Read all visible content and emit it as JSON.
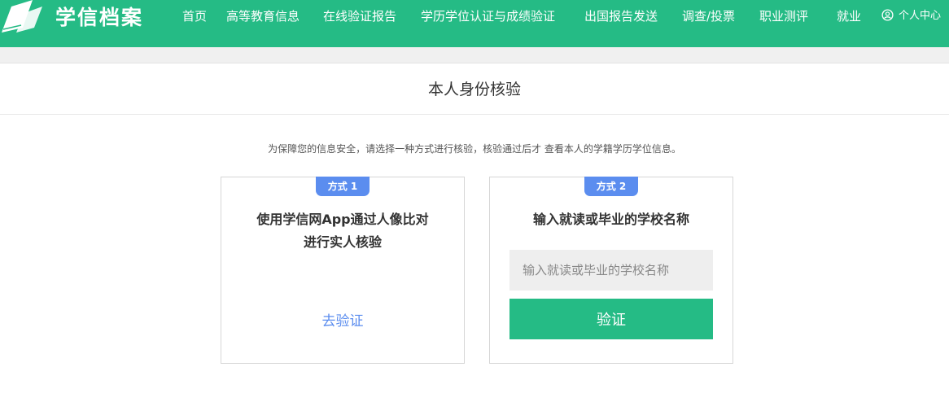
{
  "header": {
    "logo_text": "学信档案",
    "logo_icon": "open-book-icon",
    "nav": [
      {
        "label": "首页"
      },
      {
        "label": "高等教育信息"
      },
      {
        "label": "在线验证报告"
      },
      {
        "label": "学历学位认证与成绩验证"
      },
      {
        "label": "出国报告发送"
      },
      {
        "label": "调查/投票"
      },
      {
        "label": "职业测评"
      },
      {
        "label": "就业"
      }
    ],
    "user_icon": "user-circle-icon",
    "user_label": "个人中心"
  },
  "main": {
    "title": "本人身份核验",
    "notice": "为保障您的信息安全，请选择一种方式进行核验，核验通过后才 查看本人的学籍学历学位信息。",
    "method1": {
      "badge": "方式 1",
      "heading_line1": "使用学信网App通过人像比对",
      "heading_line2": "进行实人核验",
      "link": "去验证"
    },
    "method2": {
      "badge": "方式 2",
      "heading": "输入就读或毕业的学校名称",
      "input_value": "",
      "input_placeholder": "输入就读或毕业的学校名称",
      "button": "验证"
    }
  },
  "colors": {
    "brand": "#25bb85",
    "badge": "#5b8def",
    "link": "#5b8def",
    "input_bg": "#eeeeee"
  }
}
